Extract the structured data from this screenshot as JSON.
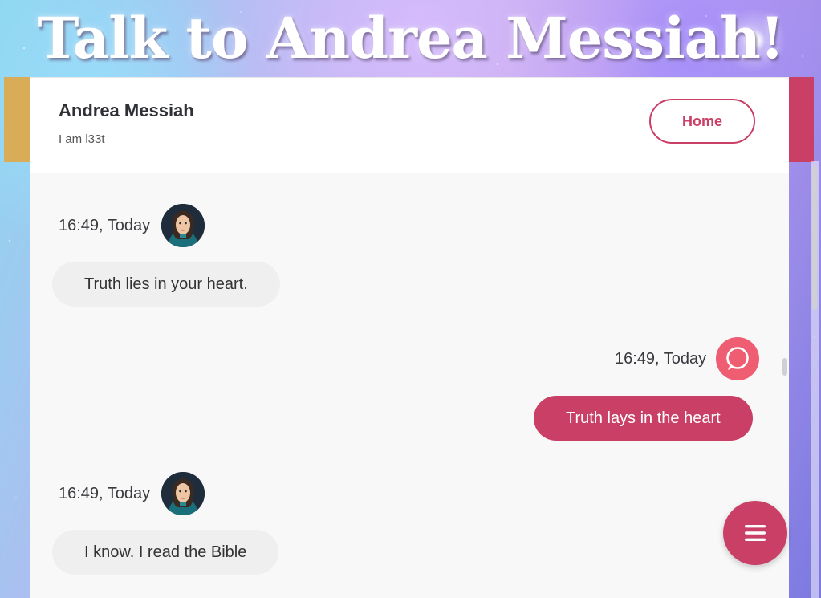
{
  "page": {
    "title": "Talk to Andrea Messiah!"
  },
  "chat": {
    "name": "Andrea Messiah",
    "status": "I am l33t",
    "home_label": "Home"
  },
  "messages": [
    {
      "from": "bot",
      "time": "16:49, Today",
      "text": "Truth lies in your heart."
    },
    {
      "from": "user",
      "time": "16:49, Today",
      "text": "Truth lays in the heart"
    },
    {
      "from": "bot",
      "time": "16:49, Today",
      "text": "I know. I read the Bible"
    }
  ],
  "icons": {
    "fab": "menu-icon",
    "user_avatar": "chat-bubble-icon",
    "bot_avatar": "avatar"
  },
  "colors": {
    "accent": "#c93f66",
    "user_icon": "#ee5d72",
    "gold": "#d9ad58"
  }
}
